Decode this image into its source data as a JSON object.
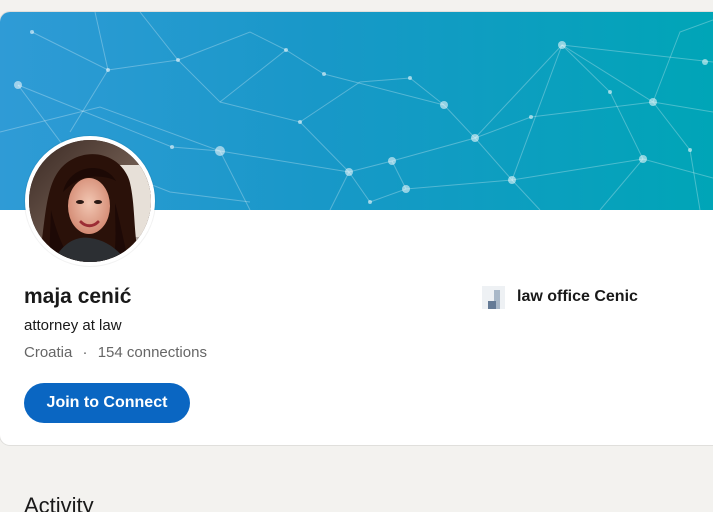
{
  "profile": {
    "name": "maja cenić",
    "headline": "attorney at law",
    "location": "Croatia",
    "separator": "·",
    "connections": "154 connections",
    "join_label": "Join to Connect",
    "company": {
      "name": "law office Cenic",
      "logo_icon": "company-logo-icon"
    },
    "avatar_icon": "profile-photo"
  },
  "sections": {
    "activity_title": "Activity"
  },
  "colors": {
    "cover_start": "#2f9bd6",
    "cover_end": "#00a5b7",
    "primary_button": "#0a66c2",
    "text_primary": "#191919",
    "text_secondary": "#666666",
    "page_background": "#f3f2ef"
  }
}
